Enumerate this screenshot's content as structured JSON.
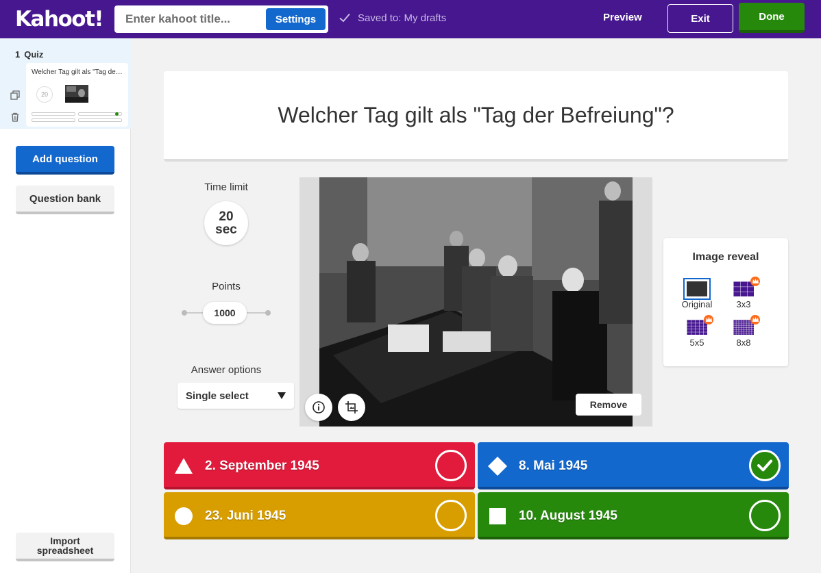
{
  "topbar": {
    "logo": "Kahoot!",
    "title_placeholder": "Enter kahoot title...",
    "settings_label": "Settings",
    "saved_text": "Saved to: My drafts",
    "preview_label": "Preview",
    "exit_label": "Exit",
    "done_label": "Done"
  },
  "sidebar": {
    "slide_number": "1",
    "slide_type": "Quiz",
    "thumb_title": "Welcher Tag gilt als \"Tag der Befreiung\"?",
    "thumb_timer": "20",
    "add_question_label": "Add question",
    "question_bank_label": "Question bank",
    "import_label_line1": "Import",
    "import_label_line2": "spreadsheet"
  },
  "question": {
    "text": "Welcher Tag gilt als \"Tag der Befreiung\"?"
  },
  "settings": {
    "time_limit_label": "Time limit",
    "time_value": "20",
    "time_unit": "sec",
    "points_label": "Points",
    "points_value": "1000",
    "answer_options_label": "Answer options",
    "answer_options_value": "Single select"
  },
  "media": {
    "remove_label": "Remove"
  },
  "image_reveal": {
    "title": "Image reveal",
    "options": [
      {
        "label": "Original",
        "selected": true,
        "premium": false
      },
      {
        "label": "3x3",
        "selected": false,
        "premium": true
      },
      {
        "label": "5x5",
        "selected": false,
        "premium": true
      },
      {
        "label": "8x8",
        "selected": false,
        "premium": true
      }
    ]
  },
  "answers": [
    {
      "text": "2. September 1945",
      "color": "#e21b3c",
      "shape": "triangle",
      "correct": false
    },
    {
      "text": "8. Mai 1945",
      "color": "#1368ce",
      "shape": "diamond",
      "correct": true
    },
    {
      "text": "23. Juni 1945",
      "color": "#d89e00",
      "shape": "circle",
      "correct": false
    },
    {
      "text": "10. August 1945",
      "color": "#26890c",
      "shape": "square",
      "correct": false
    }
  ]
}
